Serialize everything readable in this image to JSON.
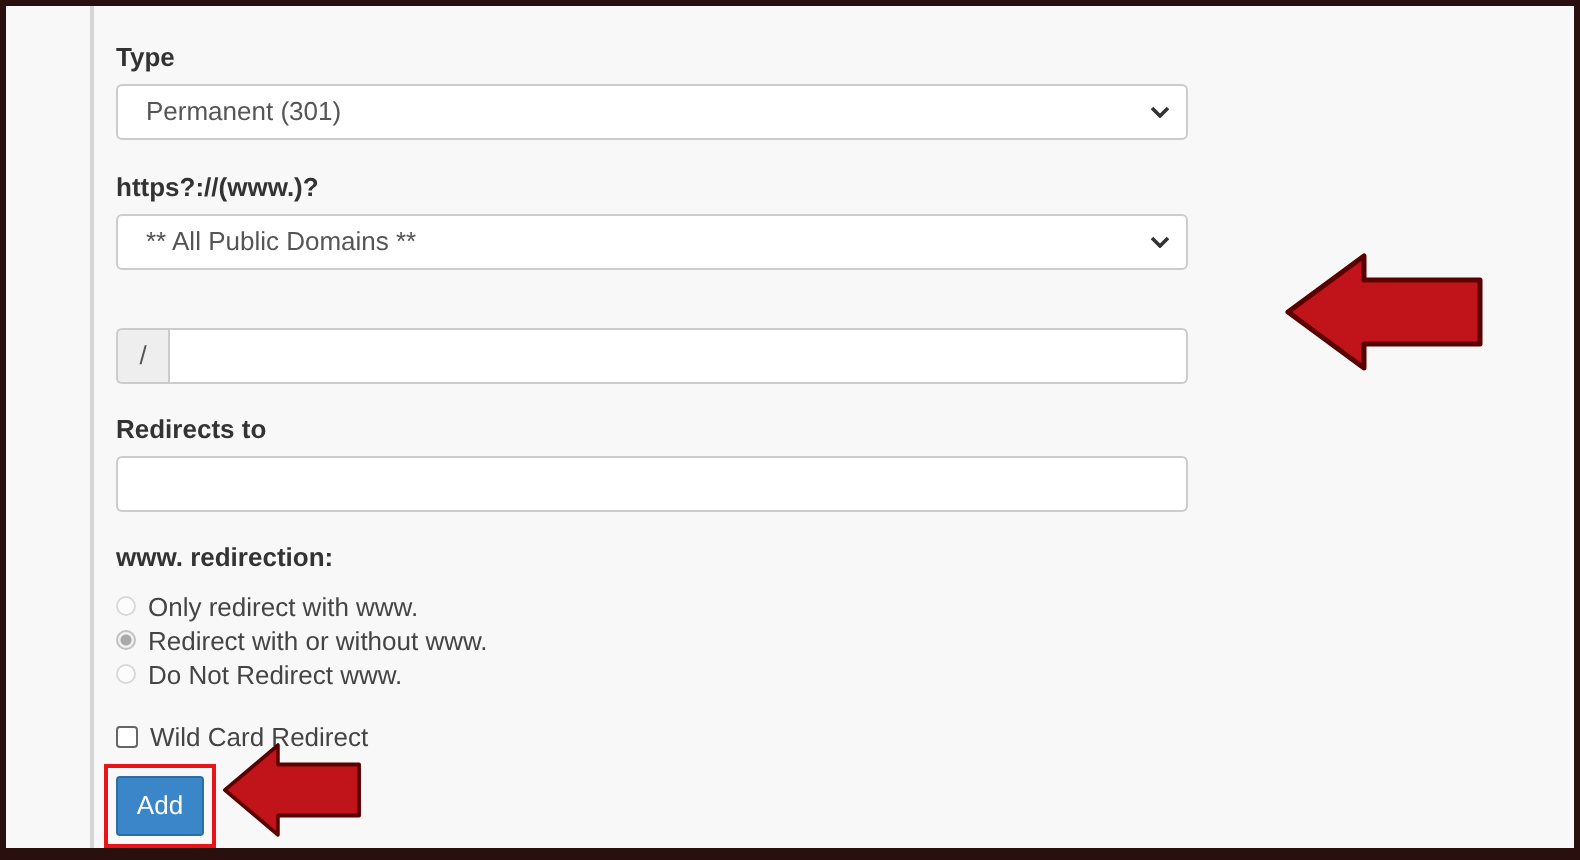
{
  "form": {
    "type": {
      "label": "Type",
      "value": "Permanent (301)"
    },
    "domain": {
      "label": "https?://(www.)?",
      "value": "** All Public Domains **"
    },
    "path": {
      "prefix": "/"
    },
    "redirects_to": {
      "label": "Redirects to"
    },
    "www_redirection": {
      "label": "www. redirection:",
      "options": [
        {
          "label": "Only redirect with www.",
          "selected": false,
          "disabled": true
        },
        {
          "label": "Redirect with or without www.",
          "selected": true,
          "disabled": true
        },
        {
          "label": "Do Not Redirect www.",
          "selected": false,
          "disabled": true
        }
      ]
    },
    "wildcard": {
      "label": "Wild Card Redirect",
      "checked": false
    },
    "add_button": {
      "label": "Add",
      "highlighted": true
    }
  }
}
